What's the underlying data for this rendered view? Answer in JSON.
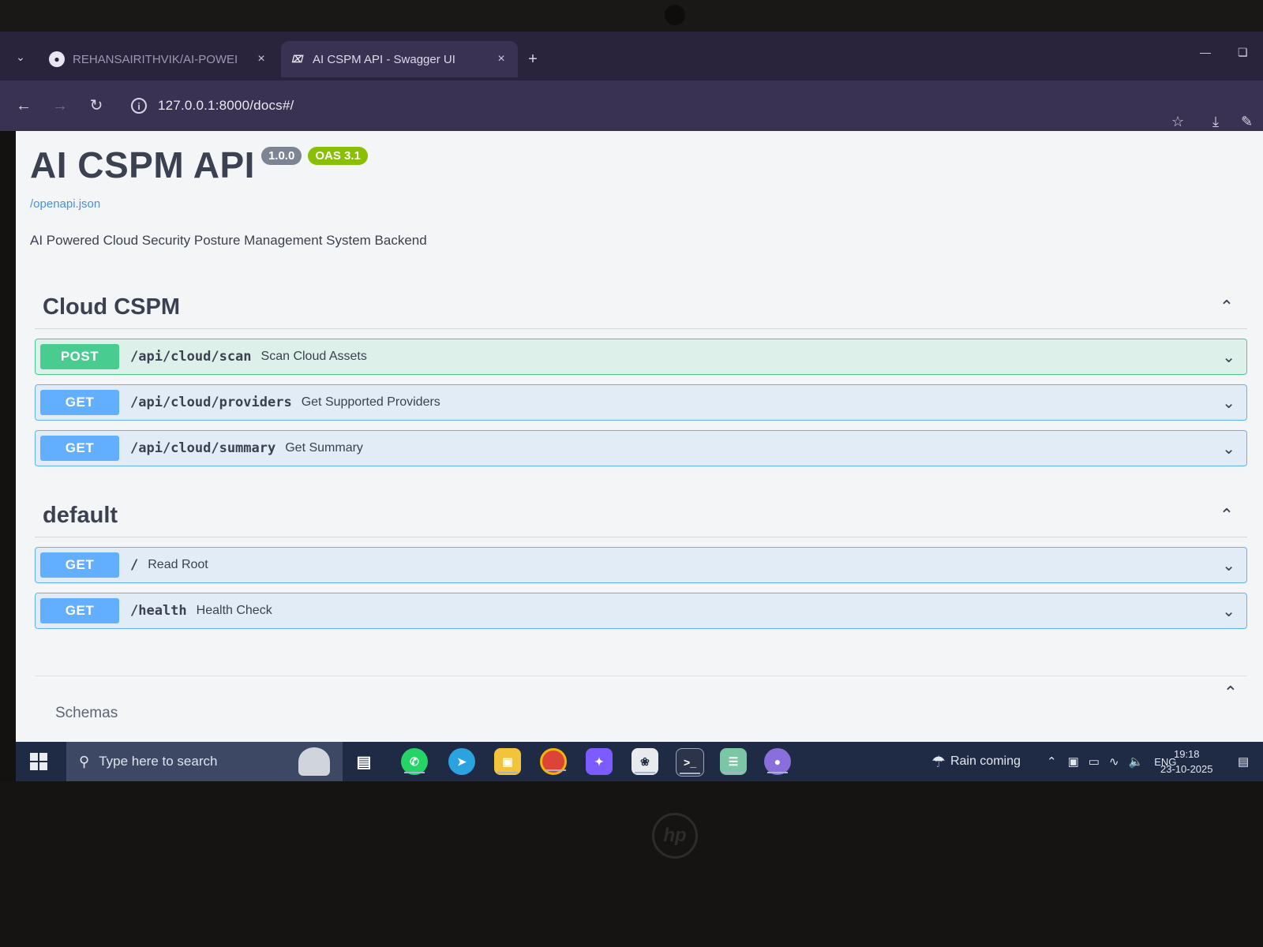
{
  "browser": {
    "tabs": [
      {
        "title": "REHANSAIRITHVIK/AI-POWEI",
        "favicon": "github-icon",
        "active": false
      },
      {
        "title": "AI CSPM API - Swagger UI",
        "favicon": "swagger-icon",
        "active": true
      }
    ],
    "url": "127.0.0.1:8000/docs#/"
  },
  "api": {
    "title": "AI CSPM API",
    "version": "1.0.0",
    "oas": "OAS 3.1",
    "spec_link": "/openapi.json",
    "description": "AI Powered Cloud Security Posture Management System Backend"
  },
  "tags": [
    {
      "name": "Cloud CSPM",
      "operations": [
        {
          "method": "POST",
          "path": "/api/cloud/scan",
          "summary": "Scan Cloud Assets"
        },
        {
          "method": "GET",
          "path": "/api/cloud/providers",
          "summary": "Get Supported Providers"
        },
        {
          "method": "GET",
          "path": "/api/cloud/summary",
          "summary": "Get Summary"
        }
      ]
    },
    {
      "name": "default",
      "operations": [
        {
          "method": "GET",
          "path": "/",
          "summary": "Read Root"
        },
        {
          "method": "GET",
          "path": "/health",
          "summary": "Health Check"
        }
      ]
    }
  ],
  "schemas_label": "Schemas",
  "taskbar": {
    "search_placeholder": "Type here to search",
    "apps": [
      "task-view-icon",
      "whatsapp-icon",
      "telegram-icon",
      "file-explorer-icon",
      "chrome-icon",
      "copilot-icon",
      "chatgpt-icon",
      "terminal-icon",
      "notepad-icon",
      "github-desktop-icon"
    ],
    "weather": "Rain coming",
    "language": "ENG",
    "time": "19:18",
    "date": "23-10-2025"
  },
  "colors": {
    "post": "#49cc90",
    "get": "#61affe",
    "version_badge": "#7d8492",
    "oas_badge": "#89bf04",
    "browser_frame": "#29233c",
    "taskbar": "#1f2b45"
  }
}
